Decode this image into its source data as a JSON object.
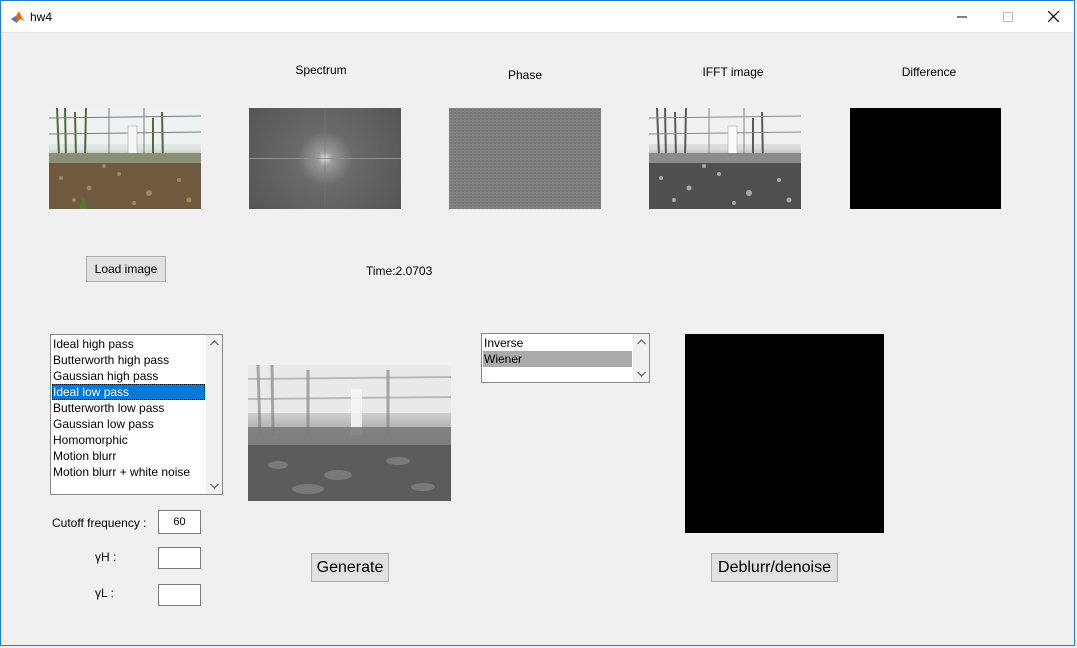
{
  "window": {
    "title": "hw4"
  },
  "headers": {
    "spectrum": "Spectrum",
    "phase": "Phase",
    "ifft": "IFFT image",
    "difference": "Difference"
  },
  "load_button": "Load image",
  "time_text": "Time:2.0703",
  "filter_list": {
    "items": [
      "Ideal high pass",
      "Butterworth high pass",
      "Gaussian high pass",
      "Ideal low pass",
      "Butterworth low pass",
      "Gaussian low pass",
      "Homomorphic",
      "Motion blurr",
      "Motion blurr + white noise"
    ],
    "selected": "Ideal low pass"
  },
  "restore_list": {
    "items": [
      "Inverse",
      "Wiener"
    ],
    "selected": "Wiener"
  },
  "params": {
    "cutoff_label": "Cutoff frequency :",
    "cutoff_value": "60",
    "yh_label": "γH :",
    "yh_value": "",
    "yl_label": "γL :",
    "yl_value": ""
  },
  "generate_button": "Generate",
  "deblur_button": "Deblurr/denoise",
  "icons": {
    "app": "matlab-icon",
    "min": "minimize-icon",
    "max": "maximize-icon",
    "close": "close-icon"
  }
}
